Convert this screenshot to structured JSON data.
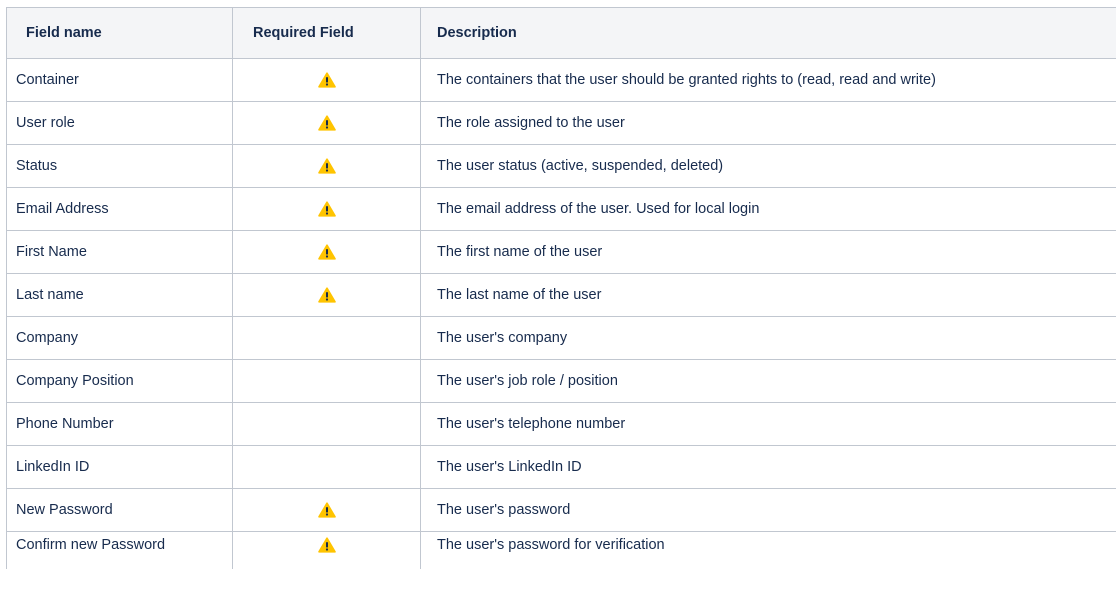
{
  "table": {
    "headers": {
      "field_name": "Field name",
      "required_field": "Required Field",
      "description": "Description"
    },
    "icons": {
      "required_icon": "warning-icon",
      "required_color": "#ffc400"
    },
    "rows": [
      {
        "field": "Container",
        "required": true,
        "description": "The containers that the user should be granted rights to (read, read and write)"
      },
      {
        "field": "User role",
        "required": true,
        "description": "The role assigned to the user"
      },
      {
        "field": "Status",
        "required": true,
        "description": "The user status (active, suspended, deleted)"
      },
      {
        "field": "Email Address",
        "required": true,
        "description": "The email address of the user. Used for local login"
      },
      {
        "field": "First Name",
        "required": true,
        "description": "The first name of the user"
      },
      {
        "field": "Last name",
        "required": true,
        "description": "The last name of the user"
      },
      {
        "field": "Company",
        "required": false,
        "description": "The user's company"
      },
      {
        "field": "Company Position",
        "required": false,
        "description": "The user's job role / position"
      },
      {
        "field": "Phone Number",
        "required": false,
        "description": "The user's telephone number"
      },
      {
        "field": "LinkedIn ID",
        "required": false,
        "description": "The user's LinkedIn ID"
      },
      {
        "field": "New Password",
        "required": true,
        "description": "The user's password"
      },
      {
        "field": "Confirm new Password",
        "required": true,
        "description": "The user's password for verification"
      }
    ]
  }
}
